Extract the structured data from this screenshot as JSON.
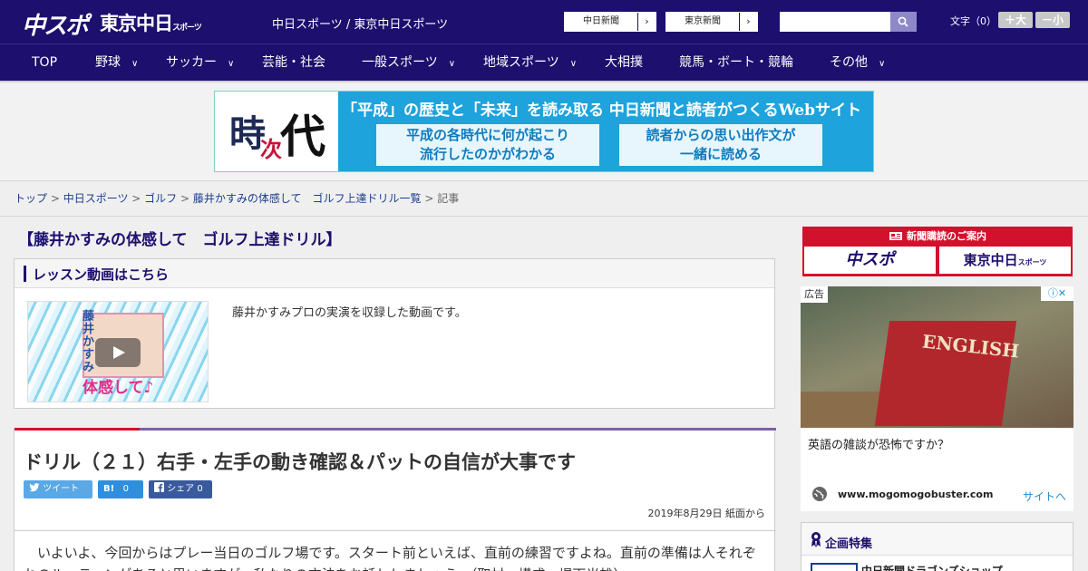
{
  "header": {
    "logo_chunichi": "中スポ",
    "logo_tokyo": "東京中日",
    "logo_tokyo_small": "スポーツ",
    "site_name": "中日スポーツ / 東京中日スポーツ",
    "ext_links": [
      {
        "label": "中日新聞",
        "arrow": "›"
      },
      {
        "label": "東京新聞",
        "arrow": "›"
      }
    ],
    "search_placeholder": "",
    "font_size_label": "文字（0）",
    "font_larger": "＋大",
    "font_smaller": "－小"
  },
  "nav": [
    {
      "label": "TOP",
      "has_dropdown": false
    },
    {
      "label": "野球",
      "has_dropdown": true
    },
    {
      "label": "サッカー",
      "has_dropdown": true
    },
    {
      "label": "芸能・社会",
      "has_dropdown": false
    },
    {
      "label": "一般スポーツ",
      "has_dropdown": true
    },
    {
      "label": "地域スポーツ",
      "has_dropdown": true
    },
    {
      "label": "大相撲",
      "has_dropdown": false
    },
    {
      "label": "競馬・ボート・競輪",
      "has_dropdown": false
    },
    {
      "label": "その他",
      "has_dropdown": true
    }
  ],
  "nav_chevron": "∨",
  "banner": {
    "kanji_1": "時",
    "kanji_2": "次",
    "kanji_3": "代",
    "headline": "「平成」の歴史と「未来」を読み取る 中日新聞と読者がつくるWebサイト",
    "box_1_line_1": "平成の各時代に何が起こり",
    "box_1_line_2": "流行したのかがわかる",
    "box_2_line_1": "読者からの思い出作文が",
    "box_2_line_2": "一緒に読める"
  },
  "breadcrumb": {
    "items": [
      "トップ",
      "中日スポーツ",
      "ゴルフ",
      "藤井かすみの体感して　ゴルフ上達ドリル一覧"
    ],
    "current": "記事",
    "separator": " > "
  },
  "page_title": "【藤井かすみの体感して　ゴルフ上達ドリル】",
  "video": {
    "heading": "レッスン動画はこちら",
    "thumb_name": "藤井かすみ",
    "thumb_caption": "体感して♪",
    "description": "藤井かすみプロの実演を収録した動画です。"
  },
  "article": {
    "title": "ドリル（２１）右手・左手の動き確認＆パットの自信が大事です",
    "tweet_label": "ツイート",
    "hatena_label": "B!",
    "hatena_count": "0",
    "share_label": "シェア",
    "share_count": "0",
    "date": "2019年8月29日 紙面から",
    "body": "　いよいよ、今回からはプレー当日のゴルフ場です。スタート前といえば、直前の練習ですよね。直前の準備は人それぞれのルーティンがあると思いますが、私なりの方法をお話ししましょう。（取材・構成＝堤下光雄）"
  },
  "sidebar": {
    "subscribe_title": "新聞購読のご案内",
    "subscribe_logo_1": "中スポ",
    "subscribe_logo_2": "東京中日",
    "subscribe_logo_2_small": "スポーツ",
    "ad_label": "広告",
    "ad_image_word": "ENGLISH",
    "ad_text": "英語の雑談が恐怖ですか？",
    "ad_domain": "www.mogomogobuster.com",
    "ad_link": "サイトへ",
    "kikaku_title": "企画特集",
    "kikaku_item": "中日新聞ドラゴンズショップ"
  },
  "colors": {
    "brand_navy": "#1c0f6e",
    "accent_red": "#d2122c",
    "link_blue": "#1c3d8e"
  }
}
